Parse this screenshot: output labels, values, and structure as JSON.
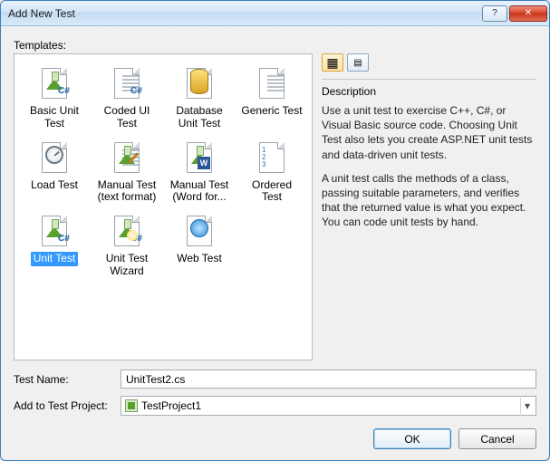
{
  "window": {
    "title": "Add New Test"
  },
  "section": {
    "templates_label": "Templates:"
  },
  "templates": [
    {
      "name": "Basic Unit Test",
      "icon": "basic-unit-test"
    },
    {
      "name": "Coded UI Test",
      "icon": "coded-ui-test"
    },
    {
      "name": "Database Unit Test",
      "icon": "db-unit-test"
    },
    {
      "name": "Generic Test",
      "icon": "generic-test"
    },
    {
      "name": "Load Test",
      "icon": "load-test"
    },
    {
      "name": "Manual Test (text format)",
      "icon": "manual-text"
    },
    {
      "name": "Manual Test (Word for...",
      "icon": "manual-word"
    },
    {
      "name": "Ordered Test",
      "icon": "ordered-test"
    },
    {
      "name": "Unit Test",
      "icon": "unit-test",
      "selected": true
    },
    {
      "name": "Unit Test Wizard",
      "icon": "unit-test-wizard"
    },
    {
      "name": "Web Test",
      "icon": "web-test"
    }
  ],
  "viewmode": {
    "large": true
  },
  "description": {
    "heading": "Description",
    "p1": "Use a unit test to exercise C++, C#, or Visual Basic source code. Choosing Unit Test also lets you create ASP.NET unit tests and data-driven unit tests.",
    "p2": "A unit test calls the methods of a class, passing suitable parameters, and verifies that the returned value is what you expect. You can code unit tests by hand."
  },
  "fields": {
    "test_name_label": "Test Name:",
    "test_name_value": "UnitTest2.cs",
    "project_label": "Add to Test Project:",
    "project_value": "TestProject1"
  },
  "buttons": {
    "ok": "OK",
    "cancel": "Cancel"
  }
}
